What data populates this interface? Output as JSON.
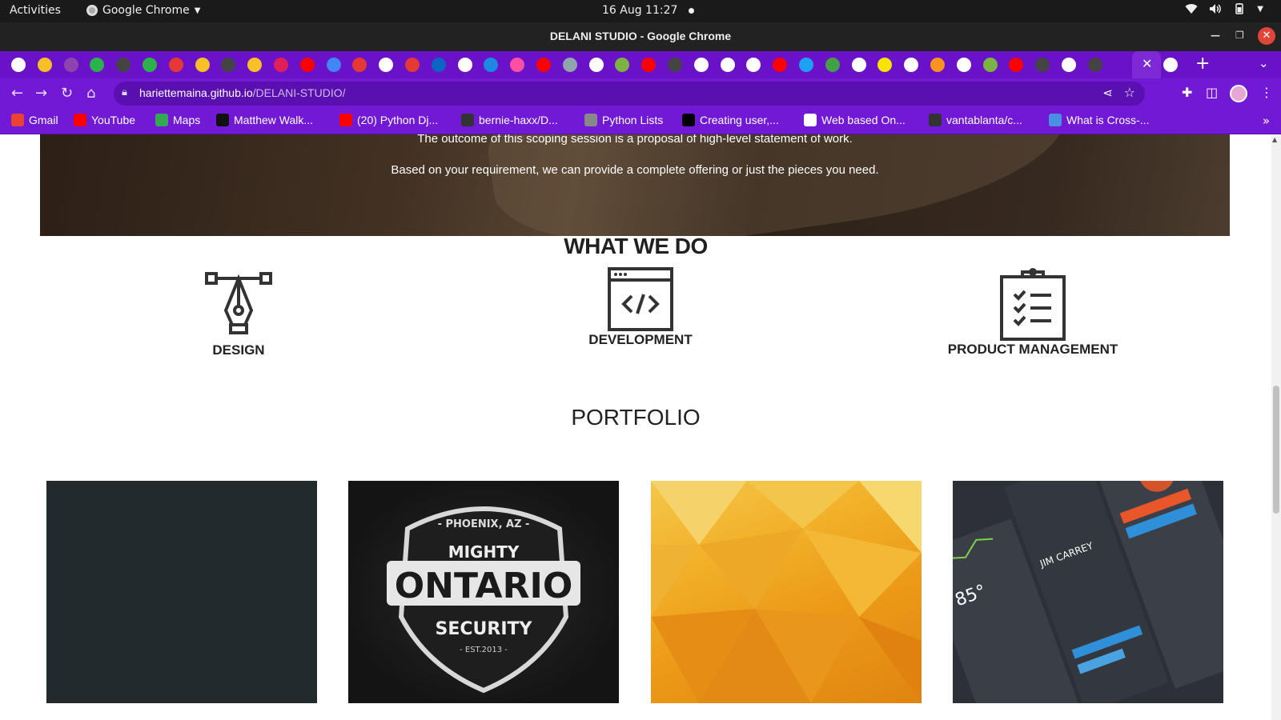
{
  "system": {
    "activities": "Activities",
    "app_name": "Google Chrome",
    "clock": "16 Aug  11:27"
  },
  "window": {
    "title": "DELANI STUDIO - Google Chrome"
  },
  "tabs": {
    "count_visible": 44,
    "active_close": "✕",
    "new_tab": "+"
  },
  "address": {
    "domain": "hariettemaina.github.io",
    "path": "/DELANI-STUDIO/"
  },
  "bookmarks": [
    {
      "label": "Gmail",
      "color": "#ea4335"
    },
    {
      "label": "YouTube",
      "color": "#ff0000"
    },
    {
      "label": "Maps",
      "color": "#34a853"
    },
    {
      "label": "Matthew Walk...",
      "color": "#111111"
    },
    {
      "label": "(20) Python Dj...",
      "color": "#ff0000"
    },
    {
      "label": "bernie-haxx/D...",
      "color": "#333333"
    },
    {
      "label": "Python Lists",
      "color": "#888888"
    },
    {
      "label": "Creating user,...",
      "color": "#000000"
    },
    {
      "label": "Web based On...",
      "color": "#ffffff"
    },
    {
      "label": "vantablanta/c...",
      "color": "#333333"
    },
    {
      "label": "What is Cross-...",
      "color": "#4a90e2"
    }
  ],
  "hero": {
    "line1": "The outcome of this scoping session is a proposal of high-level statement of work.",
    "line2": "Based on your requirement, we can provide a complete offering or just the pieces you need."
  },
  "what_we_do": {
    "title": "WHAT WE DO",
    "services": [
      {
        "label": "DESIGN",
        "icon": "pen-tool-icon"
      },
      {
        "label": "DEVELOPMENT",
        "icon": "code-window-icon"
      },
      {
        "label": "PRODUCT MANAGEMENT",
        "icon": "clipboard-checklist-icon"
      }
    ]
  },
  "portfolio": {
    "title": "PORTFOLIO",
    "items": [
      {
        "name": "portfolio-item-1",
        "color": "#222a2e"
      },
      {
        "name": "portfolio-item-2",
        "caption": "MIGHTY ONTARIO SECURITY",
        "top": "- PHOENIX, AZ -",
        "est": "- EST.2013 -"
      },
      {
        "name": "portfolio-item-3",
        "color": "#f2b12a"
      },
      {
        "name": "portfolio-item-4",
        "name_label": "JIM CARREY",
        "temp": "85°"
      }
    ]
  },
  "colors": {
    "browser_accent": "#7119d4",
    "tabstrip": "#6a12c8"
  }
}
